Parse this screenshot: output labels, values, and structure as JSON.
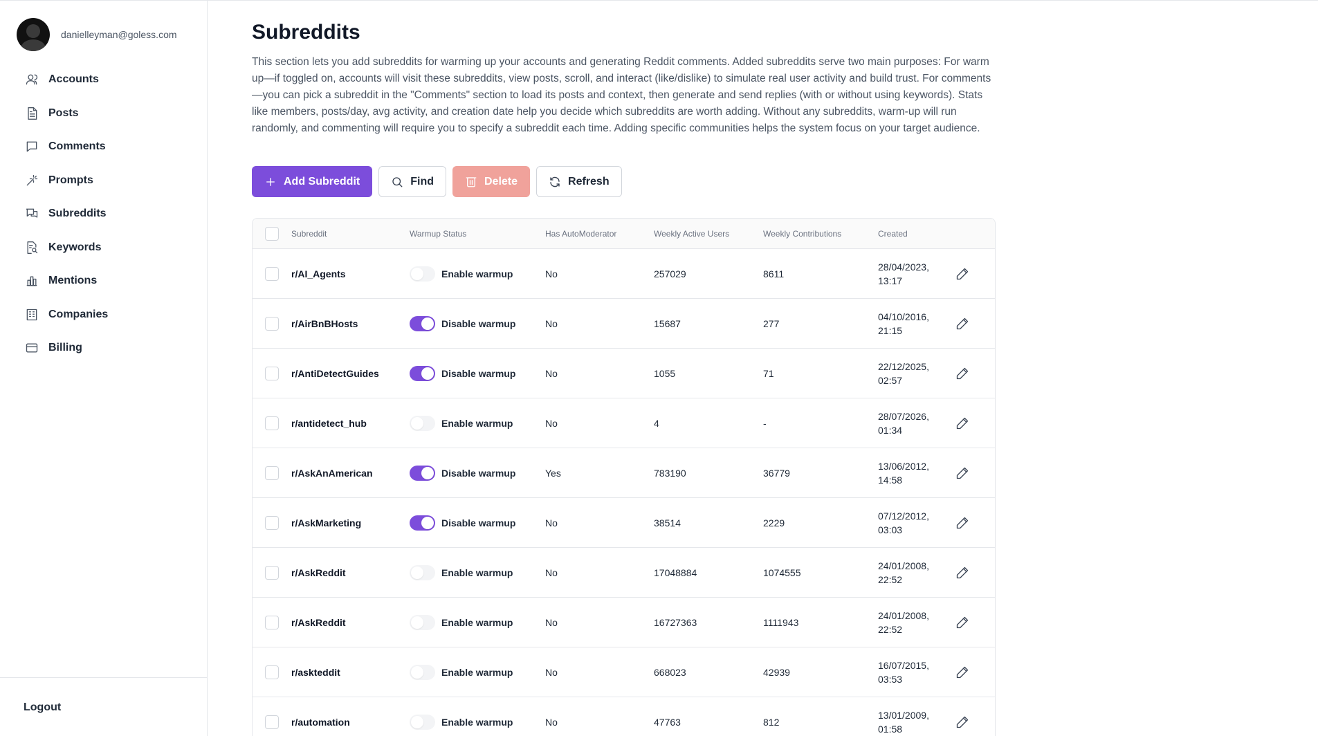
{
  "user": {
    "email": "danielleyman@goless.com"
  },
  "sidebar": {
    "items": [
      {
        "label": "Accounts",
        "icon": "user-icon"
      },
      {
        "label": "Posts",
        "icon": "document-icon"
      },
      {
        "label": "Comments",
        "icon": "comment-icon"
      },
      {
        "label": "Prompts",
        "icon": "magic-wand-icon"
      },
      {
        "label": "Subreddits",
        "icon": "chat-bubbles-icon"
      },
      {
        "label": "Keywords",
        "icon": "file-search-icon"
      },
      {
        "label": "Mentions",
        "icon": "bar-chart-icon"
      },
      {
        "label": "Companies",
        "icon": "building-icon"
      },
      {
        "label": "Billing",
        "icon": "credit-card-icon"
      }
    ],
    "logout_label": "Logout"
  },
  "page": {
    "title": "Subreddits",
    "description": "This section lets you add subreddits for warming up your accounts and generating Reddit comments. Added subreddits serve two main purposes: For warm up—if toggled on, accounts will visit these subreddits, view posts, scroll, and interact (like/dislike) to simulate real user activity and build trust. For comments—you can pick a subreddit in the \"Comments\" section to load its posts and context, then generate and send replies (with or without using keywords). Stats like members, posts/day, avg activity, and creation date help you decide which subreddits are worth adding. Without any subreddits, warm-up will run randomly, and commenting will require you to specify a subreddit each time. Adding specific communities helps the system focus on your target audience."
  },
  "toolbar": {
    "add_label": "Add Subreddit",
    "find_label": "Find",
    "delete_label": "Delete",
    "refresh_label": "Refresh"
  },
  "table": {
    "headers": {
      "subreddit": "Subreddit",
      "warmup": "Warmup Status",
      "automod": "Has AutoModerator",
      "wau": "Weekly Active Users",
      "wc": "Weekly Contributions",
      "created": "Created"
    },
    "rows": [
      {
        "name": "r/AI_Agents",
        "warmup_on": false,
        "warmup_label": "Enable warmup",
        "automod": "No",
        "wau": "257029",
        "wc": "8611",
        "created_date": "28/04/2023,",
        "created_time": "13:17"
      },
      {
        "name": "r/AirBnBHosts",
        "warmup_on": true,
        "warmup_label": "Disable warmup",
        "automod": "No",
        "wau": "15687",
        "wc": "277",
        "created_date": "04/10/2016,",
        "created_time": "21:15"
      },
      {
        "name": "r/AntiDetectGuides",
        "warmup_on": true,
        "warmup_label": "Disable warmup",
        "automod": "No",
        "wau": "1055",
        "wc": "71",
        "created_date": "22/12/2025,",
        "created_time": "02:57"
      },
      {
        "name": "r/antidetect_hub",
        "warmup_on": false,
        "warmup_label": "Enable warmup",
        "automod": "No",
        "wau": "4",
        "wc": "-",
        "created_date": "28/07/2026,",
        "created_time": "01:34"
      },
      {
        "name": "r/AskAnAmerican",
        "warmup_on": true,
        "warmup_label": "Disable warmup",
        "automod": "Yes",
        "wau": "783190",
        "wc": "36779",
        "created_date": "13/06/2012,",
        "created_time": "14:58"
      },
      {
        "name": "r/AskMarketing",
        "warmup_on": true,
        "warmup_label": "Disable warmup",
        "automod": "No",
        "wau": "38514",
        "wc": "2229",
        "created_date": "07/12/2012,",
        "created_time": "03:03"
      },
      {
        "name": "r/AskReddit",
        "warmup_on": false,
        "warmup_label": "Enable warmup",
        "automod": "No",
        "wau": "17048884",
        "wc": "1074555",
        "created_date": "24/01/2008,",
        "created_time": "22:52"
      },
      {
        "name": "r/AskReddit",
        "warmup_on": false,
        "warmup_label": "Enable warmup",
        "automod": "No",
        "wau": "16727363",
        "wc": "1111943",
        "created_date": "24/01/2008,",
        "created_time": "22:52"
      },
      {
        "name": "r/askteddit",
        "warmup_on": false,
        "warmup_label": "Enable warmup",
        "automod": "No",
        "wau": "668023",
        "wc": "42939",
        "created_date": "16/07/2015,",
        "created_time": "03:53"
      },
      {
        "name": "r/automation",
        "warmup_on": false,
        "warmup_label": "Enable warmup",
        "automod": "No",
        "wau": "47763",
        "wc": "812",
        "created_date": "13/01/2009,",
        "created_time": "01:58"
      }
    ]
  },
  "colors": {
    "accent": "#7c4ddb",
    "danger": "#f0a29b"
  }
}
